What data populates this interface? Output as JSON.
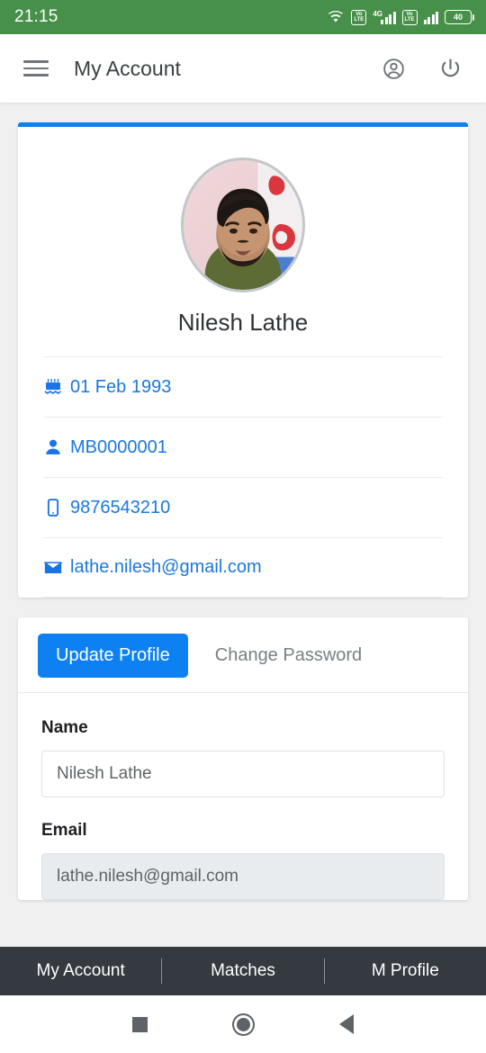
{
  "statusbar": {
    "time": "21:15",
    "wifi_icon": "wifi-icon",
    "volte_label_top": "Vo",
    "volte_label_bottom": "LTE",
    "network_type": "4G",
    "battery_level": "40"
  },
  "appbar": {
    "menu_icon": "hamburger-menu-icon",
    "title": "My Account",
    "account_icon": "account-circle-icon",
    "power_icon": "power-icon"
  },
  "profile_card": {
    "avatar_alt": "Nilesh Lathe profile photo",
    "name": "Nilesh Lathe",
    "info": [
      {
        "icon": "birthday-cake-icon",
        "value": "01 Feb 1993"
      },
      {
        "icon": "person-icon",
        "value": "MB0000001"
      },
      {
        "icon": "mobile-phone-icon",
        "value": "9876543210"
      },
      {
        "icon": "envelope-icon",
        "value": "lathe.nilesh@gmail.com"
      }
    ]
  },
  "tabs": [
    {
      "label": "Update Profile",
      "active": true
    },
    {
      "label": "Change Password",
      "active": false
    }
  ],
  "form": {
    "fields": [
      {
        "label": "Name",
        "value": "Nilesh Lathe",
        "placeholder": "Name",
        "disabled": false
      },
      {
        "label": "Email",
        "value": "lathe.nilesh@gmail.com",
        "placeholder": "Email",
        "disabled": true
      }
    ]
  },
  "bottom_nav": [
    {
      "label": "My Account"
    },
    {
      "label": "Matches"
    },
    {
      "label": "M Profile"
    }
  ],
  "android_nav": {
    "recent_icon": "square-recents-icon",
    "home_icon": "circle-home-icon",
    "back_icon": "triangle-back-icon"
  },
  "colors": {
    "status_bar_green": "#479049",
    "accent_blue": "#0d80f2",
    "link_blue": "#1a78e0",
    "bottom_nav_dark": "#343a40",
    "page_background": "#f0f0f0"
  }
}
